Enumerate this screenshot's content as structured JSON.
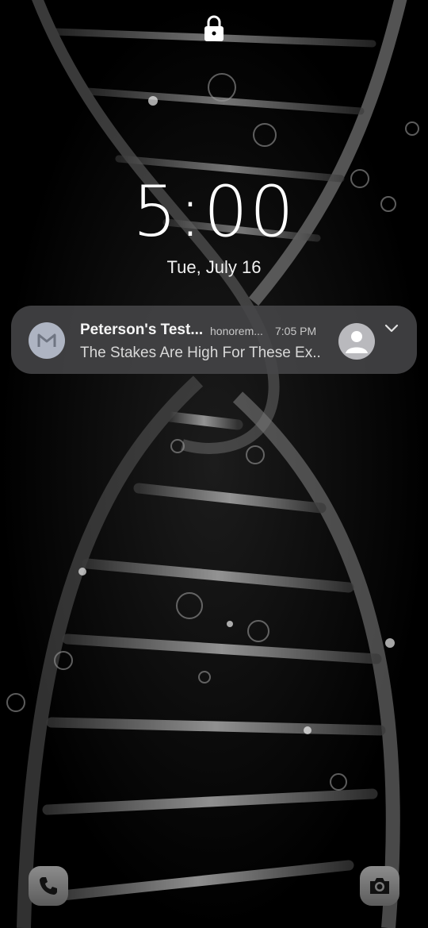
{
  "lockscreen": {
    "time": "5:00",
    "date": "Tue, July 16"
  },
  "notification": {
    "app_icon": "gmail-icon",
    "title": "Peterson's Test...",
    "account": "honorem...",
    "time": "7:05 PM",
    "body": "The Stakes Are High For These Ex..",
    "expand_icon": "chevron-down-icon"
  },
  "shortcuts": {
    "left_icon": "phone-icon",
    "right_icon": "camera-icon"
  },
  "colors": {
    "background": "#000000",
    "notification_bg": "#464648",
    "text_primary": "#ffffff",
    "avatar_bg": "#b9b9bd"
  }
}
